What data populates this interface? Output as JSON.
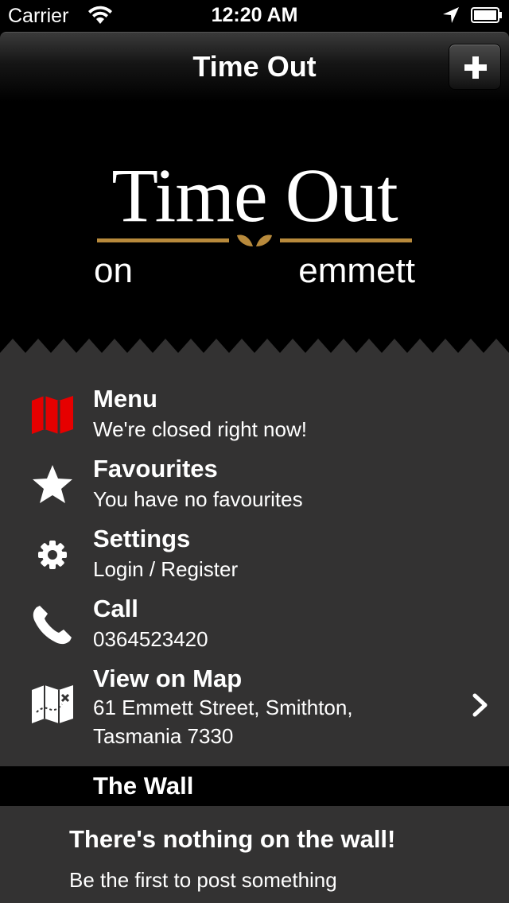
{
  "status_bar": {
    "carrier": "Carrier",
    "time": "12:20 AM",
    "icons": [
      "wifi-icon",
      "location-arrow-icon",
      "battery-icon"
    ]
  },
  "nav": {
    "title": "Time Out",
    "add_icon": "plus-icon"
  },
  "logo": {
    "main": "Time Out",
    "sub": "on emmett",
    "accent_color": "#b88a3c"
  },
  "list": {
    "items": [
      {
        "icon": "map-icon",
        "title": "Menu",
        "subtitle": "We're closed right now!",
        "icon_color": "#e60000"
      },
      {
        "icon": "star-icon",
        "title": "Favourites",
        "subtitle": "You have no favourites"
      },
      {
        "icon": "gear-icon",
        "title": "Settings",
        "subtitle": "Login / Register"
      },
      {
        "icon": "phone-icon",
        "title": "Call",
        "subtitle": "0364523420"
      },
      {
        "icon": "treasure-map-icon",
        "title": "View on Map",
        "subtitle_line1": "61 Emmett Street, Smithton,",
        "subtitle_line2": "Tasmania 7330",
        "chevron": "chevron-right-icon"
      }
    ]
  },
  "wall": {
    "header": "The Wall",
    "empty_title": "There's nothing on the wall!",
    "empty_text": "Be the first to post something"
  },
  "colors": {
    "background": "#000000",
    "list_background": "#333232",
    "text": "#ffffff"
  }
}
